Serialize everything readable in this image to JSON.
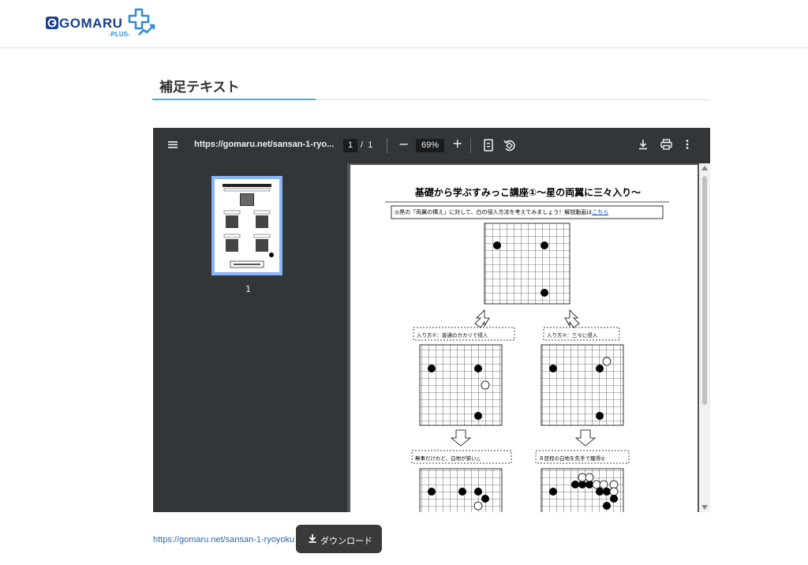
{
  "header": {
    "logo_main": "GOMARU",
    "logo_sub": "-PLUS-"
  },
  "section": {
    "title": "補足テキスト"
  },
  "viewer": {
    "doc_title": "https://gomaru.net/sansan-1-ryo...",
    "current_page": "1",
    "page_separator": "/",
    "total_pages": "1",
    "zoom": "69%",
    "thumbnail_label": "1",
    "page": {
      "heading": "基礎から学ぶすみっこ講座①～星の両翼に三々入り～",
      "intro_text": "◎黒の「両翼の構え」に対して、白の侵入方法を考えてみましょう！解説動画は",
      "intro_link": "こちら",
      "method1_label": "入り方①：普通のカカリで侵入",
      "method2_label": "入り方②：三々に侵入",
      "result1_label": "無事だけれど、白地が狭い△",
      "result2_label": "８目程の白地を先手で獲得◎"
    }
  },
  "footer": {
    "link_text": "https://gomaru.net/sansan-1-ryoyoku",
    "download_label": "ダウンロード"
  },
  "colors": {
    "brand_blue": "#1a3f8a",
    "accent_cyan": "#38b5d4",
    "viewer_toolbar": "#323639",
    "viewer_bg": "#525659",
    "thumb_highlight": "#8ab4f8"
  }
}
